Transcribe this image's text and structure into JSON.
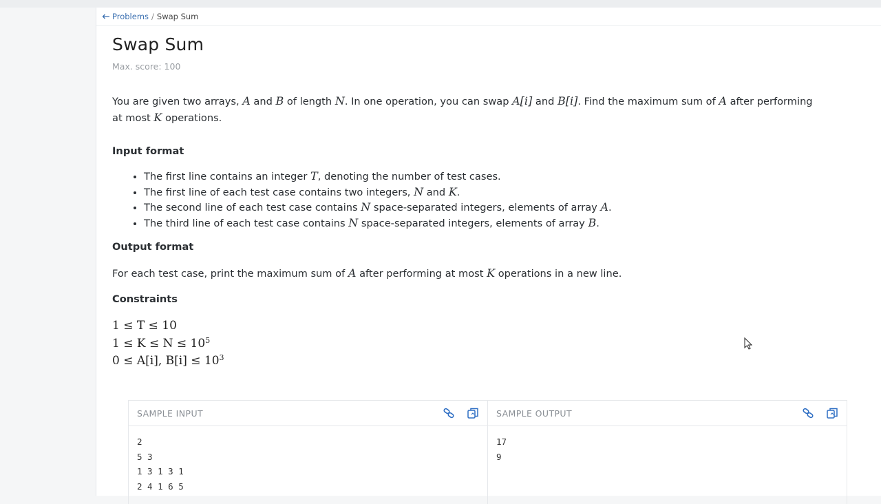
{
  "breadcrumb": {
    "back_label": "Problems",
    "separator": "/",
    "current": "Swap Sum"
  },
  "problem": {
    "title": "Swap Sum",
    "max_score": "Max. score: 100",
    "statement": {
      "t1": "You are given two arrays, ",
      "v_a": "A",
      "t2": " and ",
      "v_b": "B",
      "t3": " of length ",
      "v_n": "N",
      "t4": ". In one operation, you can swap ",
      "v_ai": "A[i]",
      "t5": " and ",
      "v_bi": "B[i]",
      "t6": ". Find the maximum sum of ",
      "v_a2": "A",
      "t7": " after performing at most ",
      "v_k": "K",
      "t8": " operations."
    },
    "input_format_heading": "Input format",
    "input_format": [
      {
        "pre": "The first line contains an integer ",
        "var": "T",
        "post": ", denoting the number of test cases."
      },
      {
        "pre": "The first line of each test case contains two integers, ",
        "var": "N",
        "mid": " and ",
        "var2": "K",
        "post": "."
      },
      {
        "pre": "The second line of each test case contains ",
        "var": "N",
        "post": " space-separated integers, elements of array ",
        "var2": "A",
        "end": "."
      },
      {
        "pre": "The third line of each test case contains ",
        "var": "N",
        "post": " space-separated integers, elements of array ",
        "var2": "B",
        "end": "."
      }
    ],
    "output_format_heading": "Output format",
    "output_format": {
      "pre": "For each test case, print the maximum sum of ",
      "var": "A",
      "mid": " after performing at most ",
      "var2": "K",
      "post": " operations in a new line."
    },
    "constraints_heading": "Constraints",
    "constraints": [
      {
        "text": "1 ≤ T ≤ 10",
        "exp": ""
      },
      {
        "text": "1 ≤ K ≤ N ≤ 10",
        "exp": "5"
      },
      {
        "text": "0 ≤ A[i], B[i] ≤ 10",
        "exp": "3"
      }
    ]
  },
  "samples": {
    "input_label": "SAMPLE INPUT",
    "output_label": "SAMPLE OUTPUT",
    "input_text": "2\n5 3\n1 3 1 3 1\n2 4 1 6 5",
    "output_text": "17\n9",
    "icons": [
      "link-icon",
      "copy-icon"
    ]
  },
  "colors": {
    "link": "#3a6fb0",
    "icon": "#2f6fc4",
    "muted": "#9a9ea3"
  }
}
